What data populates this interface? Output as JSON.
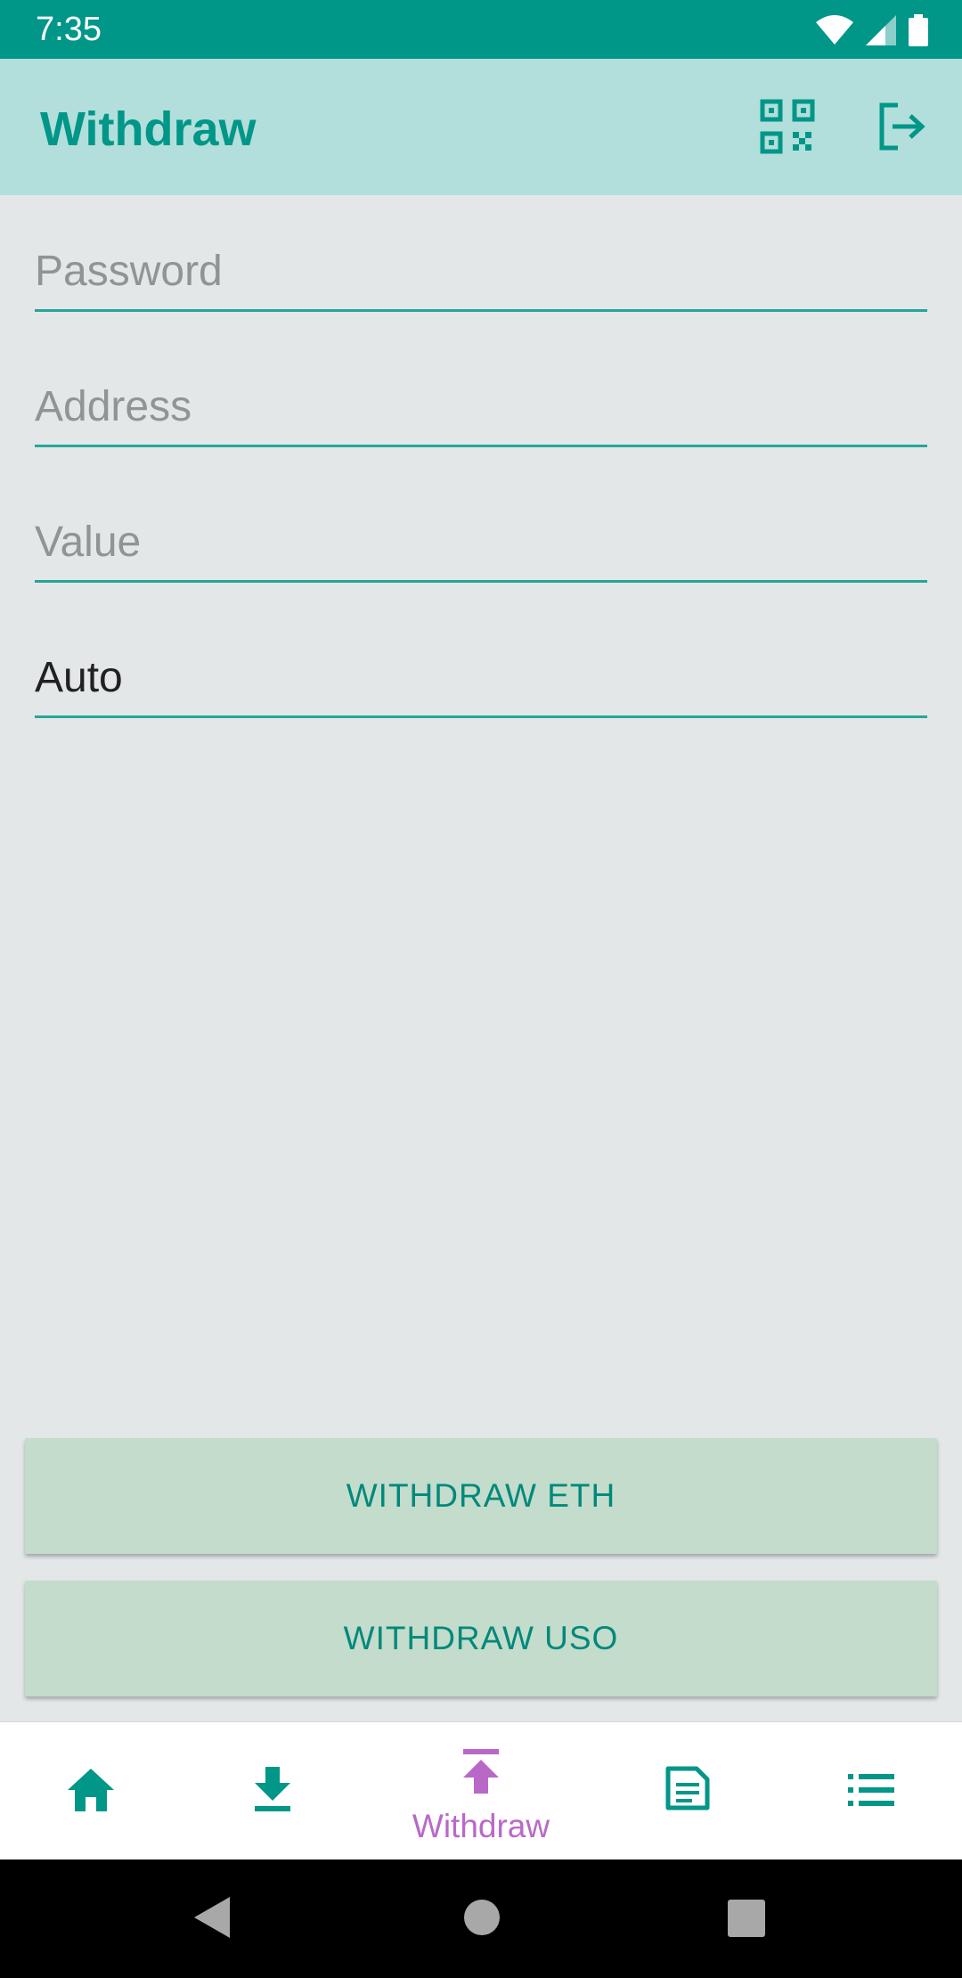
{
  "status_bar": {
    "time": "7:35"
  },
  "app_bar": {
    "title": "Withdraw",
    "actions": [
      "qr-code-icon",
      "logout-icon"
    ]
  },
  "form": {
    "password_placeholder": "Password",
    "address_placeholder": "Address",
    "value_placeholder": "Value",
    "gas_value": "Auto"
  },
  "buttons": {
    "withdraw_eth": "WITHDRAW ETH",
    "withdraw_uso": "WITHDRAW USO"
  },
  "bottom_nav": {
    "items": [
      {
        "icon": "home-icon",
        "label": ""
      },
      {
        "icon": "download-icon",
        "label": ""
      },
      {
        "icon": "upload-icon",
        "label": "Withdraw"
      },
      {
        "icon": "document-icon",
        "label": ""
      },
      {
        "icon": "list-icon",
        "label": ""
      }
    ],
    "active_index": 2
  },
  "colors": {
    "primary": "#009688",
    "app_bar_bg": "#b2dfdb",
    "active_nav": "#ba68c8",
    "button_bg": "#c4dccb",
    "screen_bg": "#e3e7e8"
  }
}
